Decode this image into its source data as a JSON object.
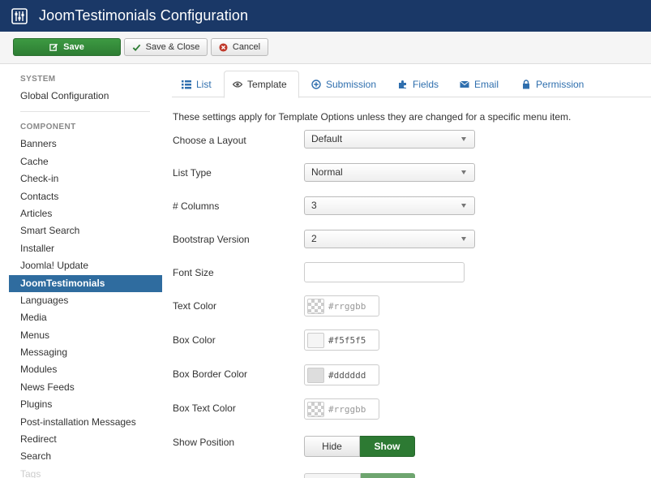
{
  "header": {
    "title": "JoomTestimonials Configuration",
    "logo_icon": "joomla-sliders-icon",
    "bg_color": "#1a3867"
  },
  "toolbar": {
    "save_label": "Save",
    "save_close_label": "Save & Close",
    "cancel_label": "Cancel"
  },
  "sidebar": {
    "system_heading": "SYSTEM",
    "system_items": [
      "Global Configuration"
    ],
    "component_heading": "COMPONENT",
    "component_items": [
      "Banners",
      "Cache",
      "Check-in",
      "Contacts",
      "Articles",
      "Smart Search",
      "Installer",
      "Joomla! Update",
      "JoomTestimonials",
      "Languages",
      "Media",
      "Menus",
      "Messaging",
      "Modules",
      "News Feeds",
      "Plugins",
      "Post-installation Messages",
      "Redirect",
      "Search",
      "Tags"
    ],
    "active_item": "JoomTestimonials"
  },
  "tabs": [
    {
      "label": "List",
      "icon": "list-icon"
    },
    {
      "label": "Template",
      "icon": "eye-icon",
      "active": true
    },
    {
      "label": "Submission",
      "icon": "plus-circle-icon"
    },
    {
      "label": "Fields",
      "icon": "puzzle-icon"
    },
    {
      "label": "Email",
      "icon": "envelope-icon"
    },
    {
      "label": "Permission",
      "icon": "lock-icon"
    }
  ],
  "form": {
    "description": "These settings apply for Template Options unless they are changed for a specific menu item.",
    "layout": {
      "label": "Choose a Layout",
      "value": "Default"
    },
    "list_type": {
      "label": "List Type",
      "value": "Normal"
    },
    "columns": {
      "label": "# Columns",
      "value": "3"
    },
    "bootstrap": {
      "label": "Bootstrap Version",
      "value": "2"
    },
    "font_size": {
      "label": "Font Size",
      "value": ""
    },
    "text_color": {
      "label": "Text Color",
      "placeholder": "#rrggbb",
      "value": ""
    },
    "box_color": {
      "label": "Box Color",
      "value": "#f5f5f5"
    },
    "box_border_color": {
      "label": "Box Border Color",
      "value": "#dddddd"
    },
    "box_text_color": {
      "label": "Box Text Color",
      "placeholder": "#rrggbb",
      "value": ""
    },
    "show_position": {
      "label": "Show Position",
      "options": [
        "Hide",
        "Show"
      ],
      "selected": "Show"
    }
  }
}
